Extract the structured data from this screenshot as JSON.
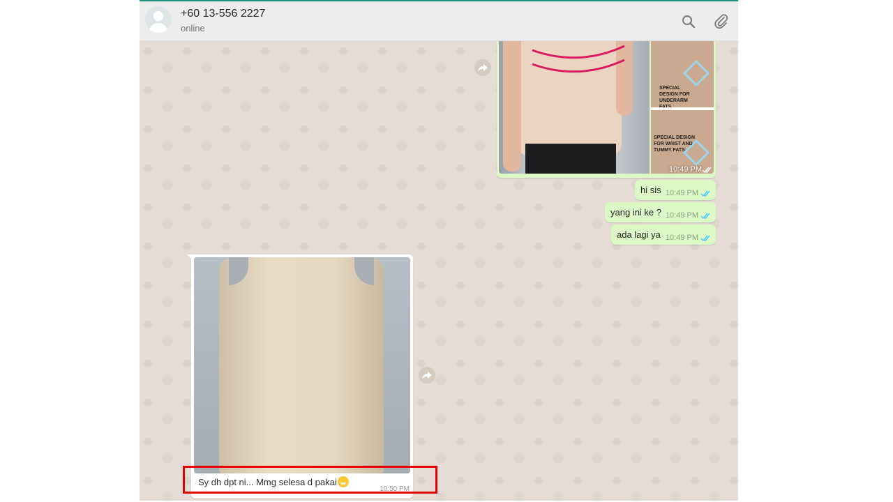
{
  "header": {
    "contact_name": "+60 13-556 2227",
    "status": "online",
    "icons": [
      "search-icon",
      "attach-icon"
    ]
  },
  "messages": {
    "image_out": {
      "panel_top_text": "SPECIAL DESIGN FOR UNDERARM FATS",
      "panel_bottom_text": "SPECIAL DESIGN FOR WAIST AND TUMMY FATS",
      "time": "10:49 PM"
    },
    "texts_out": [
      {
        "text": "hi sis",
        "time": "10:49 PM"
      },
      {
        "text": "yang ini ke ?",
        "time": "10:49 PM"
      },
      {
        "text": "ada lagi ya",
        "time": "10:49 PM"
      }
    ],
    "image_in": {
      "caption": "Sy dh dpt ni... Mmg selesa d pakai",
      "time": "10:50 PM"
    }
  },
  "colors": {
    "outgoing_bubble": "#dcf8c6",
    "incoming_bubble": "#ffffff",
    "chat_background": "#e5ddd5",
    "read_ticks": "#4fc3f7",
    "highlight": "#e30000"
  }
}
